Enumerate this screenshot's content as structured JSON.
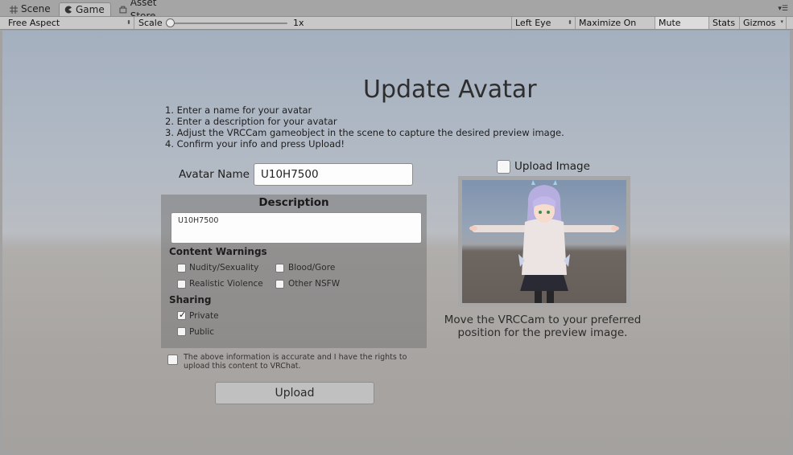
{
  "tabs": [
    {
      "label": "Scene",
      "icon": "grid-icon"
    },
    {
      "label": "Game",
      "icon": "pacman-icon"
    },
    {
      "label": "Asset Store",
      "icon": "store-icon"
    }
  ],
  "toolbar": {
    "aspect": "Free Aspect",
    "scale_label": "Scale",
    "scale_value": "1x",
    "scale_level": 0,
    "eye": "Left Eye",
    "maximize": "Maximize On Play",
    "mute": "Mute Audio",
    "stats": "Stats",
    "gizmos": "Gizmos"
  },
  "form": {
    "title": "Update Avatar",
    "steps": [
      "1. Enter a name for your avatar",
      "2. Enter a description for your avatar",
      "3. Adjust the VRCCam gameobject in the scene to capture the desired preview image.",
      "4. Confirm your info and press Upload!"
    ],
    "name_label": "Avatar Name",
    "name_value": "U10H7500",
    "description_title": "Description",
    "description_value": "U10H7500",
    "content_warnings_title": "Content Warnings",
    "warnings": [
      {
        "label": "Nudity/Sexuality",
        "checked": false
      },
      {
        "label": "Blood/Gore",
        "checked": false
      },
      {
        "label": "Realistic Violence",
        "checked": false
      },
      {
        "label": "Other NSFW",
        "checked": false
      }
    ],
    "sharing_title": "Sharing",
    "sharing": [
      {
        "label": "Private",
        "checked": true
      },
      {
        "label": "Public",
        "checked": false
      }
    ],
    "rights_text_1": "The above information is accurate and I have the rights to",
    "rights_text_2": "upload this content to VRChat.",
    "upload_label": "Upload",
    "upload_image_label": "Upload Image",
    "caption_1": "Move the VRCCam to your preferred",
    "caption_2": "position for the preview image."
  }
}
